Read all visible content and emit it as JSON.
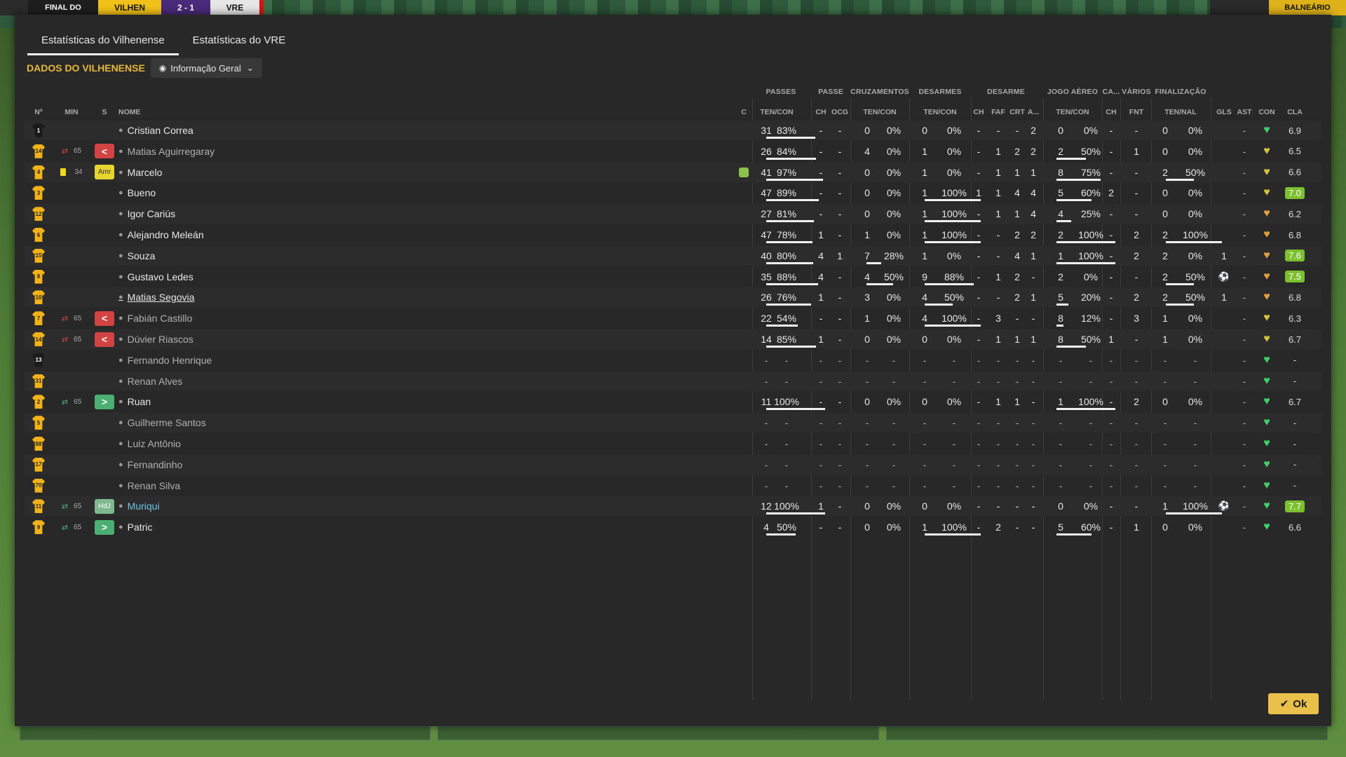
{
  "topbar": {
    "status": "FINAL DO",
    "home_team": "VILHEN",
    "score": "2 - 1",
    "away_team": "VRE",
    "right_button": "BALNEÁRIO"
  },
  "tabs": [
    {
      "label": "Estatísticas do Vilhenense",
      "active": true
    },
    {
      "label": "Estatísticas do VRE",
      "active": false
    }
  ],
  "club_label": "DADOS DO VILHENENSE",
  "view_dropdown": {
    "label": "Informação Geral",
    "icon": "eye-icon"
  },
  "group_headers": [
    "PASSES",
    "PASSE",
    "CRUZAMENTOS",
    "DESARMES",
    "DESARME",
    "JOGO AÉREO",
    "CA...",
    "VÁRIOS",
    "FINALIZAÇÃO"
  ],
  "column_headers": {
    "num": "Nº",
    "min": "MIN",
    "s": "S",
    "name": "NOME",
    "c": "C",
    "passes": "TEN/CON",
    "passe_ch": "CH",
    "passe_ocg": "OCG",
    "cruz": "TEN/CON",
    "des": "TEN/CON",
    "d_ch": "CH",
    "d_faf": "FAF",
    "d_crt": "CRT",
    "d_a": "A...",
    "aereo": "TEN/CON",
    "ca_ch": "CH",
    "fnt": "FNT",
    "fin": "TEN/NAL",
    "gls": "GLS",
    "ast": "AST",
    "con": "CON",
    "cla": "CLA"
  },
  "colors": {
    "accent": "#e6b93c",
    "positive": "#4caf72",
    "negative": "#d44343",
    "ok": "#e8c04a"
  },
  "players": [
    {
      "num": "1",
      "gk": true,
      "min": "",
      "sub": "",
      "badge": "",
      "name": "Cristian Correa",
      "style": "",
      "c": "",
      "p": [
        "31",
        "83%"
      ],
      "pch": "-",
      "pocg": "-",
      "cz": [
        "0",
        "0%"
      ],
      "ds": [
        "0",
        "0%"
      ],
      "dch": "-",
      "faf": "-",
      "crt": "-",
      "da": "2",
      "ae": [
        "0",
        "0%"
      ],
      "cach": "-",
      "fnt": "-",
      "fi": [
        "0",
        "0%"
      ],
      "gls": "",
      "ast": "-",
      "con": "green",
      "cla": "6.9",
      "cla_pill": false,
      "bars": {
        "p": 0.83,
        "cz": 0,
        "ds": 0,
        "ae": 0,
        "fi": 0
      }
    },
    {
      "num": "14",
      "min": "65",
      "sub": "out",
      "badge": "<",
      "badge_type": "red",
      "name": "Matias Aguirregaray",
      "style": "dim",
      "c": "",
      "p": [
        "26",
        "84%"
      ],
      "pch": "-",
      "pocg": "-",
      "cz": [
        "4",
        "0%"
      ],
      "ds": [
        "1",
        "0%"
      ],
      "dch": "-",
      "faf": "1",
      "crt": "2",
      "da": "2",
      "ae": [
        "2",
        "50%"
      ],
      "cach": "-",
      "fnt": "1",
      "fi": [
        "0",
        "0%"
      ],
      "gls": "",
      "ast": "-",
      "con": "mix",
      "cla": "6.5",
      "cla_pill": false,
      "bars": {
        "p": 0.84,
        "cz": 0,
        "ds": 0,
        "ae": 0.5,
        "fi": 0
      }
    },
    {
      "num": "4",
      "min": "34",
      "sub": "card",
      "badge": "Amr",
      "badge_type": "yellow",
      "name": "Marcelo",
      "style": "",
      "c": "icon",
      "p": [
        "41",
        "97%"
      ],
      "pch": "-",
      "pocg": "-",
      "cz": [
        "0",
        "0%"
      ],
      "ds": [
        "1",
        "0%"
      ],
      "dch": "-",
      "faf": "1",
      "crt": "1",
      "da": "1",
      "ae": [
        "8",
        "75%"
      ],
      "cach": "-",
      "fnt": "-",
      "fi": [
        "2",
        "50%"
      ],
      "gls": "",
      "ast": "-",
      "con": "mix",
      "cla": "6.6",
      "cla_pill": false,
      "bars": {
        "p": 0.97,
        "cz": 0,
        "ds": 0,
        "ae": 0.75,
        "fi": 0.5
      }
    },
    {
      "num": "3",
      "min": "",
      "sub": "",
      "badge": "",
      "name": "Bueno",
      "style": "",
      "c": "",
      "p": [
        "47",
        "89%"
      ],
      "pch": "-",
      "pocg": "-",
      "cz": [
        "0",
        "0%"
      ],
      "ds": [
        "1",
        "100%"
      ],
      "dch": "1",
      "faf": "1",
      "crt": "4",
      "da": "4",
      "ae": [
        "5",
        "60%"
      ],
      "cach": "2",
      "fnt": "-",
      "fi": [
        "0",
        "0%"
      ],
      "gls": "",
      "ast": "-",
      "con": "mix",
      "cla": "7.0",
      "cla_pill": true,
      "bars": {
        "p": 0.89,
        "cz": 0,
        "ds": 1,
        "ae": 0.6,
        "fi": 0
      }
    },
    {
      "num": "12",
      "min": "",
      "sub": "",
      "badge": "",
      "name": "Igor Cariús",
      "style": "",
      "c": "",
      "p": [
        "27",
        "81%"
      ],
      "pch": "-",
      "pocg": "-",
      "cz": [
        "0",
        "0%"
      ],
      "ds": [
        "1",
        "100%"
      ],
      "dch": "-",
      "faf": "1",
      "crt": "1",
      "da": "4",
      "ae": [
        "4",
        "25%"
      ],
      "cach": "-",
      "fnt": "-",
      "fi": [
        "0",
        "0%"
      ],
      "gls": "",
      "ast": "-",
      "con": "orange",
      "cla": "6.2",
      "cla_pill": false,
      "bars": {
        "p": 0.81,
        "cz": 0,
        "ds": 1,
        "ae": 0.25,
        "fi": 0
      }
    },
    {
      "num": "6",
      "min": "",
      "sub": "",
      "badge": "",
      "name": "Alejandro Meleán",
      "style": "",
      "c": "",
      "p": [
        "47",
        "78%"
      ],
      "pch": "1",
      "pocg": "-",
      "cz": [
        "1",
        "0%"
      ],
      "ds": [
        "1",
        "100%"
      ],
      "dch": "-",
      "faf": "-",
      "crt": "2",
      "da": "2",
      "ae": [
        "2",
        "100%"
      ],
      "cach": "-",
      "fnt": "2",
      "fi": [
        "2",
        "100%"
      ],
      "gls": "",
      "ast": "-",
      "con": "orange",
      "cla": "6.8",
      "cla_pill": false,
      "bars": {
        "p": 0.78,
        "cz": 0,
        "ds": 1,
        "ae": 1,
        "fi": 1
      }
    },
    {
      "num": "15",
      "min": "",
      "sub": "",
      "badge": "",
      "name": "Souza",
      "style": "",
      "c": "",
      "p": [
        "40",
        "80%"
      ],
      "pch": "4",
      "pocg": "1",
      "cz": [
        "7",
        "28%"
      ],
      "ds": [
        "1",
        "0%"
      ],
      "dch": "-",
      "faf": "-",
      "crt": "4",
      "da": "1",
      "ae": [
        "1",
        "100%"
      ],
      "cach": "-",
      "fnt": "2",
      "fi": [
        "2",
        "0%"
      ],
      "gls": "1",
      "ast": "-",
      "con": "orange",
      "cla": "7.6",
      "cla_pill": true,
      "bars": {
        "p": 0.8,
        "cz": 0.28,
        "ds": 0,
        "ae": 1,
        "fi": 0
      }
    },
    {
      "num": "8",
      "min": "",
      "sub": "",
      "badge": "",
      "name": "Gustavo Ledes",
      "style": "",
      "c": "",
      "p": [
        "35",
        "88%"
      ],
      "pch": "4",
      "pocg": "-",
      "cz": [
        "4",
        "50%"
      ],
      "ds": [
        "9",
        "88%"
      ],
      "dch": "-",
      "faf": "1",
      "crt": "2",
      "da": "-",
      "ae": [
        "2",
        "0%"
      ],
      "cach": "-",
      "fnt": "-",
      "fi": [
        "2",
        "50%"
      ],
      "gls": "ball",
      "ast": "-",
      "con": "orange",
      "cla": "7.5",
      "cla_pill": true,
      "bars": {
        "p": 0.88,
        "cz": 0.5,
        "ds": 0.88,
        "ae": 0,
        "fi": 0.5
      }
    },
    {
      "num": "10",
      "min": "",
      "sub": "",
      "badge": "",
      "name": "Matias Segovia",
      "style": "link",
      "c": "",
      "p": [
        "26",
        "76%"
      ],
      "pch": "1",
      "pocg": "-",
      "cz": [
        "3",
        "0%"
      ],
      "ds": [
        "4",
        "50%"
      ],
      "dch": "-",
      "faf": "-",
      "crt": "2",
      "da": "1",
      "ae": [
        "5",
        "20%"
      ],
      "cach": "-",
      "fnt": "2",
      "fi": [
        "2",
        "50%"
      ],
      "gls": "1",
      "ast": "-",
      "con": "orange",
      "cla": "6.8",
      "cla_pill": false,
      "bars": {
        "p": 0.76,
        "cz": 0,
        "ds": 0.5,
        "ae": 0.2,
        "fi": 0.5
      }
    },
    {
      "num": "7",
      "min": "65",
      "sub": "out",
      "badge": "<",
      "badge_type": "red",
      "name": "Fabián Castillo",
      "style": "dim",
      "c": "",
      "p": [
        "22",
        "54%"
      ],
      "pch": "-",
      "pocg": "-",
      "cz": [
        "1",
        "0%"
      ],
      "ds": [
        "4",
        "100%"
      ],
      "dch": "-",
      "faf": "3",
      "crt": "-",
      "da": "-",
      "ae": [
        "8",
        "12%"
      ],
      "cach": "-",
      "fnt": "3",
      "fi": [
        "1",
        "0%"
      ],
      "gls": "",
      "ast": "-",
      "con": "mix",
      "cla": "6.3",
      "cla_pill": false,
      "bars": {
        "p": 0.54,
        "cz": 0,
        "ds": 1,
        "ae": 0.12,
        "fi": 0
      }
    },
    {
      "num": "14",
      "min": "65",
      "sub": "out",
      "badge": "<",
      "badge_type": "red",
      "name": "Dúvier Riascos",
      "style": "dim",
      "c": "",
      "p": [
        "14",
        "85%"
      ],
      "pch": "1",
      "pocg": "-",
      "cz": [
        "0",
        "0%"
      ],
      "ds": [
        "0",
        "0%"
      ],
      "dch": "-",
      "faf": "1",
      "crt": "1",
      "da": "1",
      "ae": [
        "8",
        "50%"
      ],
      "cach": "1",
      "fnt": "-",
      "fi": [
        "1",
        "0%"
      ],
      "gls": "",
      "ast": "-",
      "con": "mix",
      "cla": "6.7",
      "cla_pill": false,
      "bars": {
        "p": 0.85,
        "cz": 0,
        "ds": 0,
        "ae": 0.5,
        "fi": 0
      }
    },
    {
      "num": "13",
      "gk": true,
      "min": "",
      "sub": "",
      "badge": "",
      "name": "Fernando Henrique",
      "style": "dim",
      "c": "",
      "empty": true,
      "con": "green",
      "cla": "-"
    },
    {
      "num": "31",
      "min": "",
      "sub": "",
      "badge": "",
      "name": "Renan Alves",
      "style": "dim",
      "c": "",
      "empty": true,
      "con": "green",
      "cla": "-"
    },
    {
      "num": "2",
      "min": "65",
      "sub": "in",
      "badge": ">",
      "badge_type": "green",
      "name": "Ruan",
      "style": "",
      "c": "",
      "p": [
        "11",
        "100%"
      ],
      "pch": "-",
      "pocg": "-",
      "cz": [
        "0",
        "0%"
      ],
      "ds": [
        "0",
        "0%"
      ],
      "dch": "-",
      "faf": "1",
      "crt": "1",
      "da": "-",
      "ae": [
        "1",
        "100%"
      ],
      "cach": "-",
      "fnt": "2",
      "fi": [
        "0",
        "0%"
      ],
      "gls": "",
      "ast": "-",
      "con": "green",
      "cla": "6.7",
      "cla_pill": false,
      "bars": {
        "p": 1,
        "cz": 0,
        "ds": 0,
        "ae": 1,
        "fi": 0
      }
    },
    {
      "num": "5",
      "min": "",
      "sub": "",
      "badge": "",
      "name": "Guilherme Santos",
      "style": "dim",
      "c": "",
      "empty": true,
      "con": "green",
      "cla": "-"
    },
    {
      "num": "88",
      "min": "",
      "sub": "",
      "badge": "",
      "name": "Luiz Antônio",
      "style": "dim",
      "c": "",
      "empty": true,
      "con": "green",
      "cla": "-"
    },
    {
      "num": "17",
      "min": "",
      "sub": "",
      "badge": "",
      "name": "Fernandinho",
      "style": "dim",
      "c": "",
      "empty": true,
      "con": "green",
      "cla": "-"
    },
    {
      "num": "70",
      "min": "",
      "sub": "",
      "badge": "",
      "name": "Renan Silva",
      "style": "dim",
      "c": "",
      "empty": true,
      "con": "green",
      "cla": "-"
    },
    {
      "num": "11",
      "min": "65",
      "sub": "in",
      "badge": "HdJ",
      "badge_type": "hdj",
      "name": "Muriqui",
      "style": "blue",
      "c": "",
      "p": [
        "12",
        "100%"
      ],
      "pch": "1",
      "pocg": "-",
      "cz": [
        "0",
        "0%"
      ],
      "ds": [
        "0",
        "0%"
      ],
      "dch": "-",
      "faf": "-",
      "crt": "-",
      "da": "-",
      "ae": [
        "0",
        "0%"
      ],
      "cach": "-",
      "fnt": "-",
      "fi": [
        "1",
        "100%"
      ],
      "gls": "ball",
      "ast": "-",
      "con": "green",
      "cla": "7.7",
      "cla_pill": true,
      "bars": {
        "p": 1,
        "cz": 0,
        "ds": 0,
        "ae": 0,
        "fi": 1
      }
    },
    {
      "num": "9",
      "min": "65",
      "sub": "in",
      "badge": ">",
      "badge_type": "green",
      "name": "Patric",
      "style": "",
      "c": "",
      "p": [
        "4",
        "50%"
      ],
      "pch": "-",
      "pocg": "-",
      "cz": [
        "0",
        "0%"
      ],
      "ds": [
        "1",
        "100%"
      ],
      "dch": "-",
      "faf": "2",
      "crt": "-",
      "da": "-",
      "ae": [
        "5",
        "60%"
      ],
      "cach": "-",
      "fnt": "1",
      "fi": [
        "0",
        "0%"
      ],
      "gls": "",
      "ast": "-",
      "con": "green",
      "cla": "6.6",
      "cla_pill": false,
      "bars": {
        "p": 0.5,
        "cz": 0,
        "ds": 1,
        "ae": 0.6,
        "fi": 0
      }
    }
  ],
  "ok_label": "Ok"
}
